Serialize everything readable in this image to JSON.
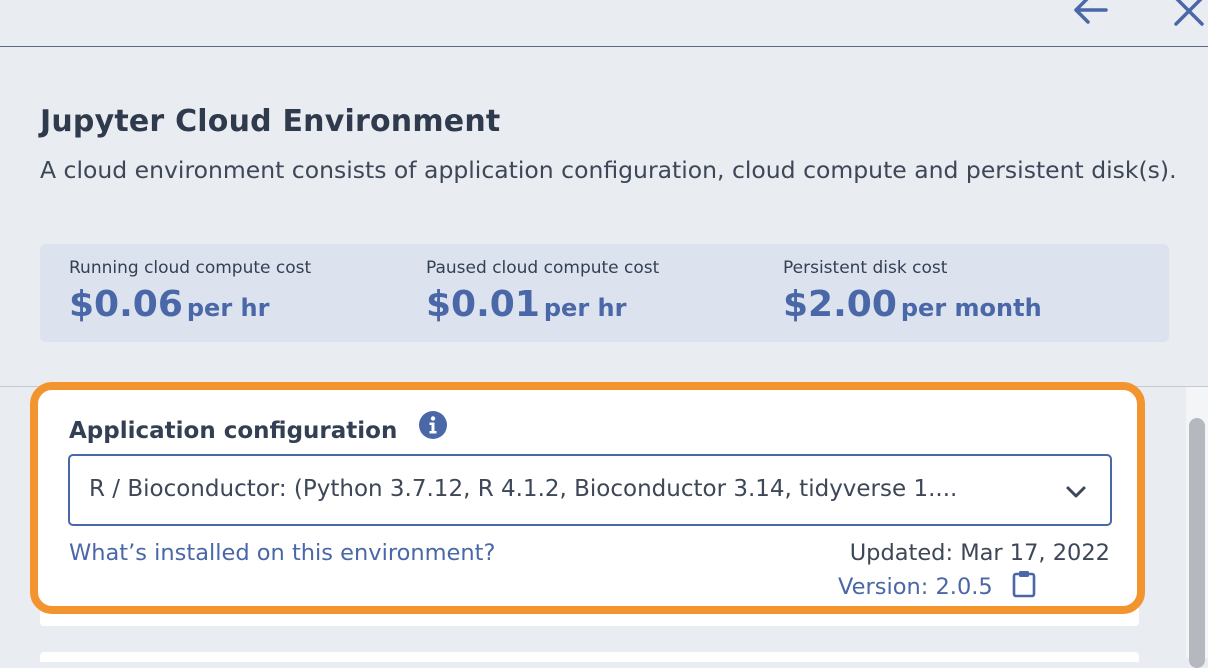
{
  "header": {
    "back_icon": "arrow-left-icon",
    "close_icon": "close-icon"
  },
  "panel": {
    "title": "Jupyter Cloud Environment",
    "description": "A cloud environment consists of application configuration, cloud compute and persistent disk(s)."
  },
  "costs": [
    {
      "label": "Running cloud compute cost",
      "amount": "$0.06",
      "unit": "per hr"
    },
    {
      "label": "Paused cloud compute cost",
      "amount": "$0.01",
      "unit": "per hr"
    },
    {
      "label": "Persistent disk cost",
      "amount": "$2.00",
      "unit": "per month"
    }
  ],
  "app_config": {
    "label": "Application configuration",
    "info_icon": "info-icon",
    "selected_value": "R / Bioconductor: (Python 3.7.12, R 4.1.2, Bioconductor 3.14, tidyverse 1....",
    "installed_link": "What’s installed on this environment?",
    "updated": "Updated: Mar 17, 2022",
    "version": "Version: 2.0.5",
    "copy_icon": "clipboard-icon"
  },
  "colors": {
    "accent": "#4a67a8",
    "highlight_border": "#f2952f",
    "background": "#e9ecf1",
    "cost_box": "#dce3ee"
  }
}
